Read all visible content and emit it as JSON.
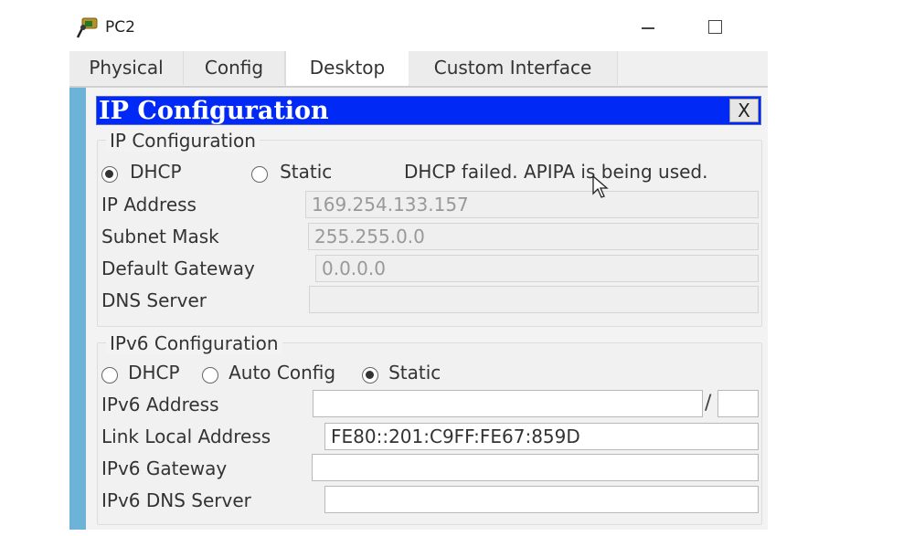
{
  "window": {
    "title": "PC2",
    "icon": "pc-device-icon",
    "minimize_label": "minimize",
    "maximize_label": "maximize"
  },
  "tabs": [
    {
      "label": "Physical",
      "active": false
    },
    {
      "label": "Config",
      "active": false
    },
    {
      "label": "Desktop",
      "active": true
    },
    {
      "label": "Custom Interface",
      "active": false
    }
  ],
  "dialog": {
    "title": "IP Configuration",
    "close_label": "X",
    "title_bg": "#0029f5"
  },
  "ipv4": {
    "group_label": "IP Configuration",
    "mode_options": [
      {
        "label": "DHCP",
        "selected": true
      },
      {
        "label": "Static",
        "selected": false
      }
    ],
    "status_message": "DHCP failed. APIPA is being used.",
    "fields": [
      {
        "label": "IP Address",
        "value": "169.254.133.157"
      },
      {
        "label": "Subnet Mask",
        "value": "255.255.0.0"
      },
      {
        "label": "Default Gateway",
        "value": "0.0.0.0"
      },
      {
        "label": "DNS Server",
        "value": ""
      }
    ]
  },
  "ipv6": {
    "group_label": "IPv6 Configuration",
    "mode_options": [
      {
        "label": "DHCP",
        "selected": false
      },
      {
        "label": "Auto Config",
        "selected": false
      },
      {
        "label": "Static",
        "selected": true
      }
    ],
    "fields": [
      {
        "label": "IPv6 Address",
        "value": "",
        "prefix_separator": "/",
        "prefix_value": ""
      },
      {
        "label": "Link Local Address",
        "value": "FE80::201:C9FF:FE67:859D"
      },
      {
        "label": "IPv6 Gateway",
        "value": ""
      },
      {
        "label": "IPv6 DNS Server",
        "value": ""
      }
    ]
  },
  "colors": {
    "accent_bar": "#6db3d8",
    "panel_bg": "#f3f3f3"
  }
}
